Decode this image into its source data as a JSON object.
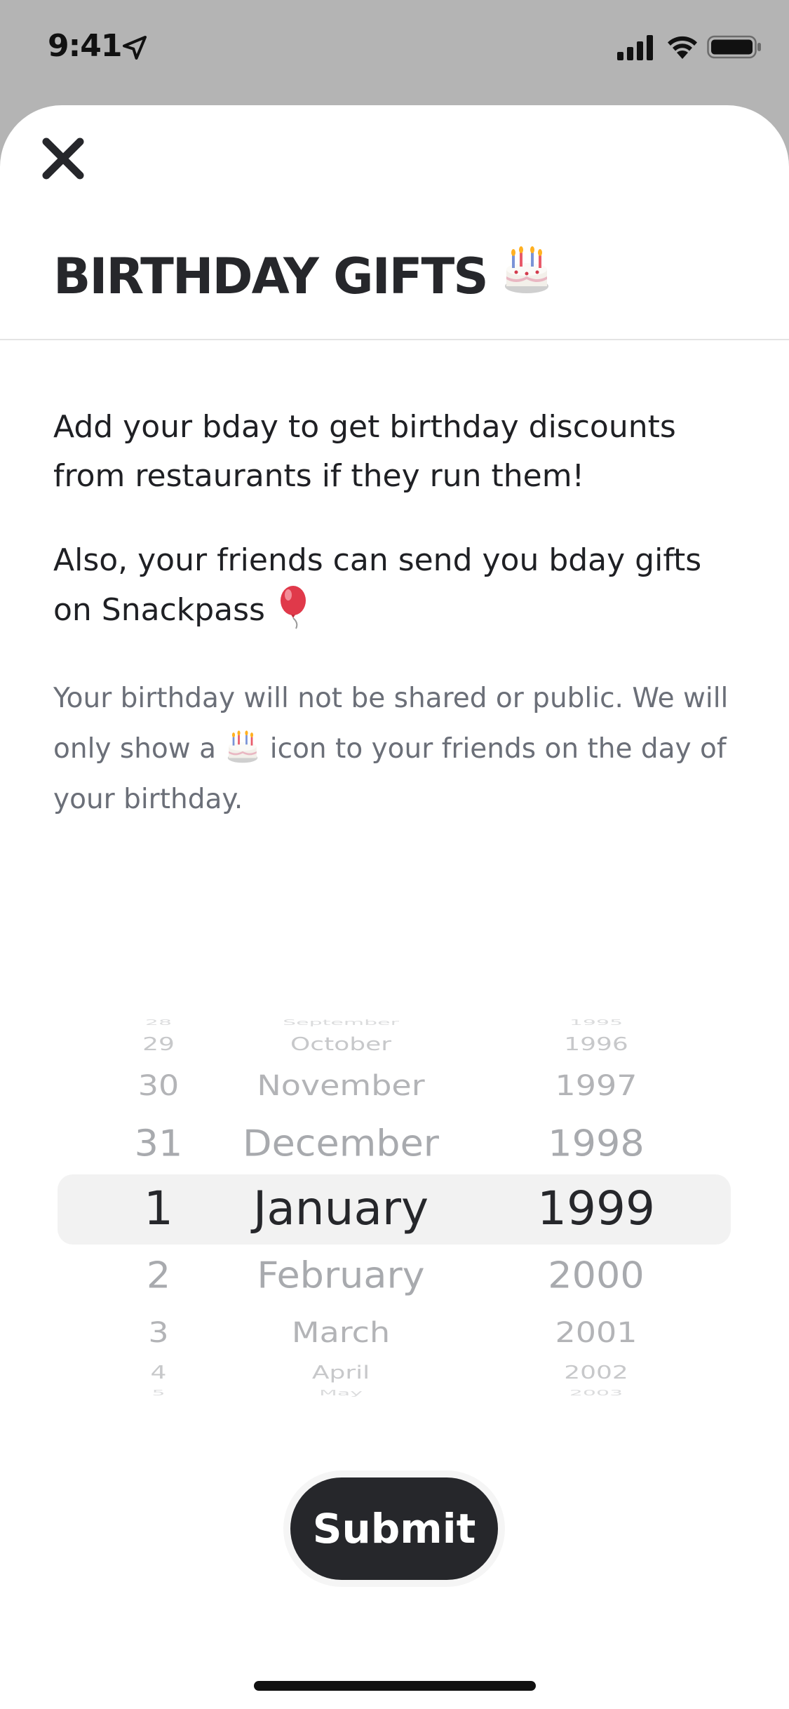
{
  "status_bar": {
    "time": "9:41"
  },
  "header": {
    "title": "BIRTHDAY GIFTS",
    "close_label": "Close"
  },
  "body": {
    "paragraph1": "Add your bday to get birthday discounts from restaurants if they run them!",
    "paragraph2": "Also, your friends can send you bday gifts on Snackpass",
    "note_part1": "Your birthday will not be shared or public. We will only show a",
    "note_part2": "icon to your friends on the day of your birthday."
  },
  "picker": {
    "days": [
      "28",
      "29",
      "30",
      "31",
      "1",
      "2",
      "3",
      "4",
      "5"
    ],
    "months": [
      "September",
      "October",
      "November",
      "December",
      "January",
      "February",
      "March",
      "April",
      "May"
    ],
    "years": [
      "1995",
      "1996",
      "1997",
      "1998",
      "1999",
      "2000",
      "2001",
      "2002",
      "2003"
    ],
    "selected": {
      "day": "1",
      "month": "January",
      "year": "1999"
    }
  },
  "submit": {
    "label": "Submit"
  },
  "colors": {
    "dark": "#26272b",
    "muted_text": "#6b6f78",
    "highlight": "#f2f2f2",
    "backdrop": "#b4b4b4"
  }
}
